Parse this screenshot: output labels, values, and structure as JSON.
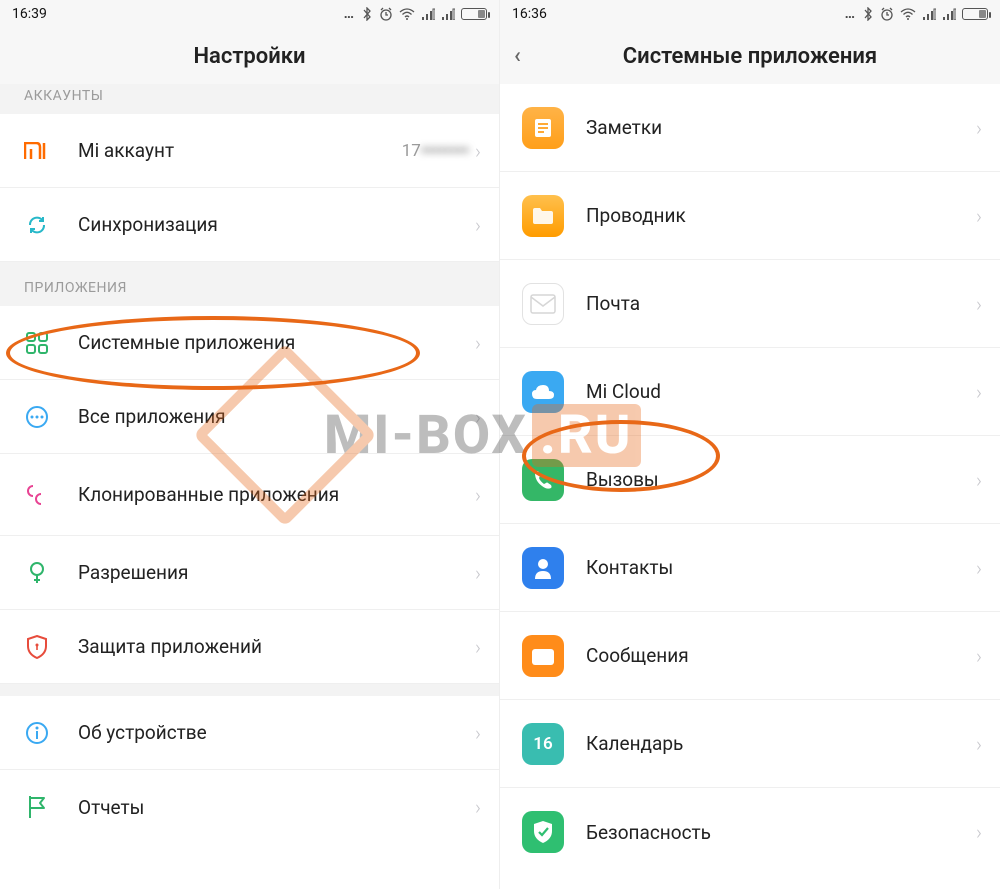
{
  "left": {
    "statusbar": {
      "time": "16:39"
    },
    "header": {
      "title": "Настройки"
    },
    "section_accounts": {
      "header": "АККАУНТЫ"
    },
    "row_mi_account": {
      "label": "Mi аккаунт",
      "value_visible": "17",
      "value_obscured": "••••••••"
    },
    "row_sync": {
      "label": "Синхронизация"
    },
    "section_apps": {
      "header": "ПРИЛОЖЕНИЯ"
    },
    "row_system_apps": {
      "label": "Системные приложения"
    },
    "row_all_apps": {
      "label": "Все приложения"
    },
    "row_cloned_apps": {
      "label": "Клонированные приложения"
    },
    "row_permissions": {
      "label": "Разрешения"
    },
    "row_app_protection": {
      "label": "Защита приложений"
    },
    "row_about": {
      "label": "Об устройстве"
    },
    "row_reports": {
      "label": "Отчеты"
    }
  },
  "right": {
    "statusbar": {
      "time": "16:36"
    },
    "header": {
      "title": "Системные приложения"
    },
    "items": [
      {
        "key": "notes",
        "label": "Заметки"
      },
      {
        "key": "explorer",
        "label": "Проводник"
      },
      {
        "key": "mail",
        "label": "Почта"
      },
      {
        "key": "micloud",
        "label": "Mi Cloud"
      },
      {
        "key": "calls",
        "label": "Вызовы"
      },
      {
        "key": "contacts",
        "label": "Контакты"
      },
      {
        "key": "messages",
        "label": "Сообщения"
      },
      {
        "key": "calendar",
        "label": "Календарь",
        "day": "16"
      },
      {
        "key": "security",
        "label": "Безопасность"
      }
    ]
  },
  "watermark": {
    "text": "MI-BOX",
    "tld": ".RU"
  }
}
